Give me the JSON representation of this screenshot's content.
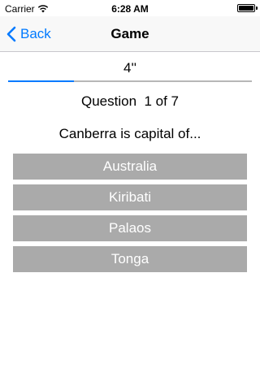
{
  "status_bar": {
    "carrier": "Carrier",
    "time": "6:28 AM",
    "wifi_icon": "wifi-icon",
    "battery_icon": "battery-icon",
    "battery_level": 1.0
  },
  "nav": {
    "back_label": "Back",
    "back_icon": "chevron-left-icon",
    "title": "Game",
    "accent_color": "#007aff"
  },
  "game": {
    "timer": "4''",
    "progress": 0.27,
    "progress_color": "#007aff",
    "question_counter": "Question  1 of 7",
    "question": "Canberra is capital of...",
    "answers": [
      "Australia",
      "Kiribati",
      "Palaos",
      "Tonga"
    ],
    "answer_background": "#aaaaaa"
  }
}
